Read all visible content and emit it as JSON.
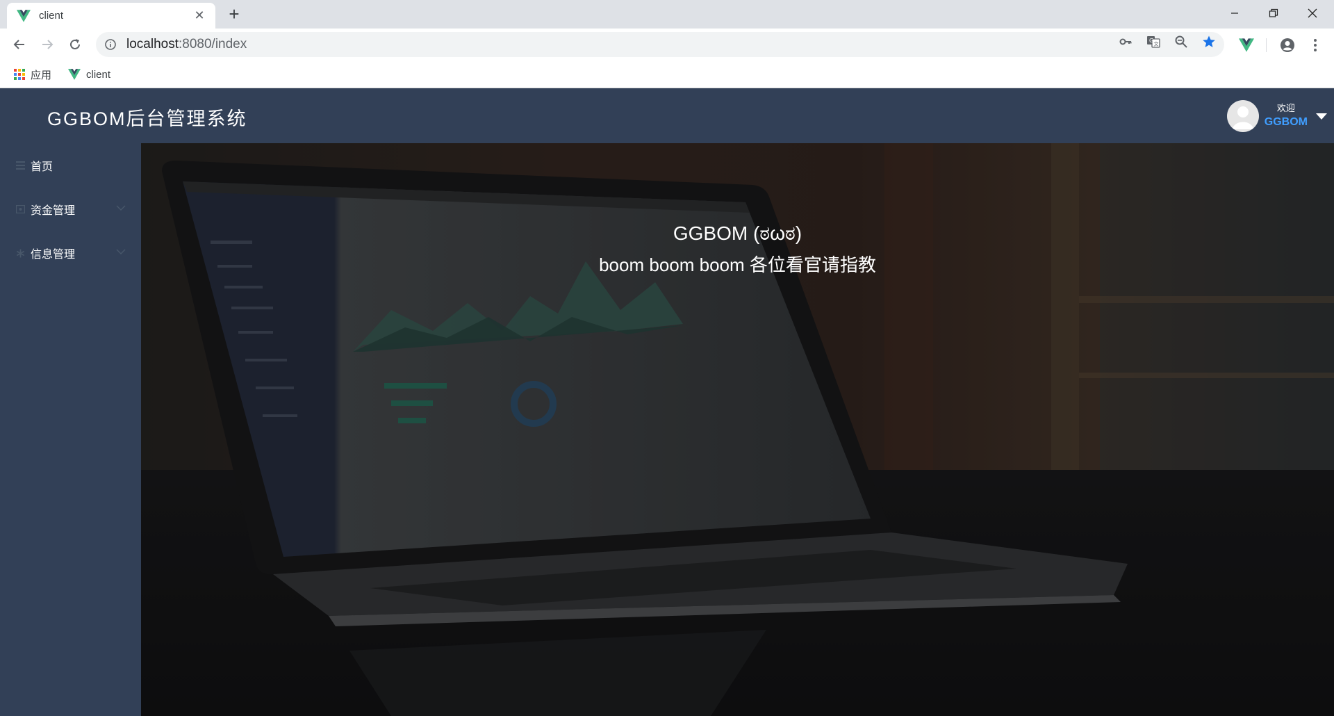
{
  "browser": {
    "tab_title": "client",
    "url_host": "localhost",
    "url_rest": ":8080/index",
    "bookmarks": [
      {
        "label": "应用"
      },
      {
        "label": "client"
      }
    ]
  },
  "header": {
    "title": "GGBOM后台管理系统",
    "welcome_label": "欢迎",
    "username": "GGBOM"
  },
  "sidebar": {
    "items": [
      {
        "label": "首页"
      },
      {
        "label": "资金管理"
      },
      {
        "label": "信息管理"
      }
    ]
  },
  "main": {
    "hero_title": "GGBOM (ಠωಠ)",
    "hero_subtitle": "boom boom boom 各位看官请指教"
  },
  "colors": {
    "header_bg": "#324057",
    "sidebar_bg": "#324057",
    "username_accent": "#409eff",
    "vue_green": "#41b883"
  }
}
